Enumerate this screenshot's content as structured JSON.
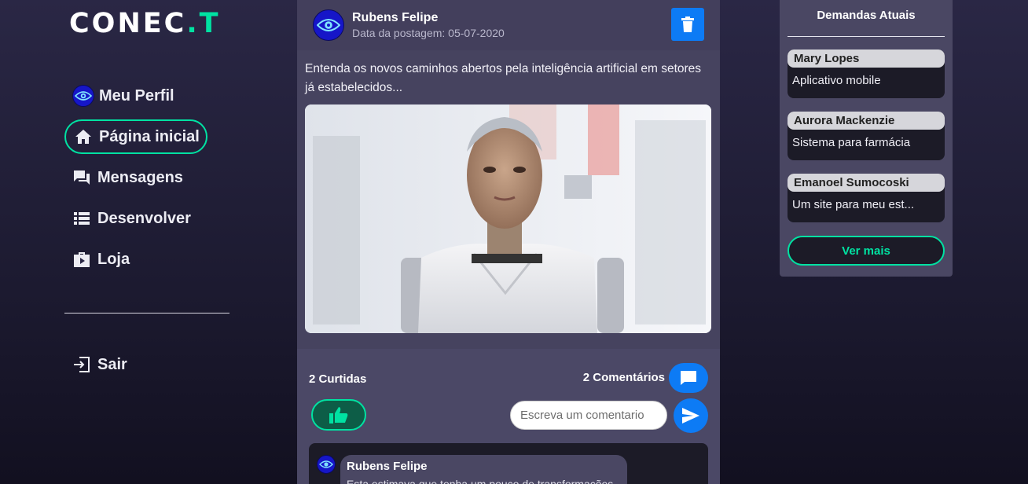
{
  "app": {
    "logo_main": "CONEC",
    "logo_dot": ".",
    "logo_tail": "T",
    "accent": "#00e2a2",
    "primary": "#0d7bf5"
  },
  "sidebar": {
    "items": [
      {
        "label": "Meu Perfil",
        "icon": "eye-avatar-icon"
      },
      {
        "label": "Página inicial",
        "icon": "home-icon",
        "active": true
      },
      {
        "label": "Mensagens",
        "icon": "chat-icon"
      },
      {
        "label": "Desenvolver",
        "icon": "list-icon"
      },
      {
        "label": "Loja",
        "icon": "shopping-bag-icon"
      }
    ],
    "logout_label": "Sair"
  },
  "post": {
    "author": "Rubens Felipe",
    "date": "Data da postagem: 05-07-2020",
    "text": "Entenda os novos caminhos abertos pela inteligência artificial em setores já estabelecidos...",
    "likes": "2 Curtidas",
    "comments": "2 Comentários",
    "comment_placeholder": "Escreva um comentario",
    "first_comment": {
      "author": "Rubens Felipe",
      "text": "Esta estimava que tenha um pouco de transformações..."
    }
  },
  "demands": {
    "title": "Demandas Atuais",
    "items": [
      {
        "name": "Mary Lopes",
        "desc": "Aplicativo mobile"
      },
      {
        "name": "Aurora Mackenzie",
        "desc": "Sistema para farmácia"
      },
      {
        "name": "Emanoel Sumocoski",
        "desc": "Um site para meu est..."
      }
    ],
    "more_label": "Ver mais"
  }
}
